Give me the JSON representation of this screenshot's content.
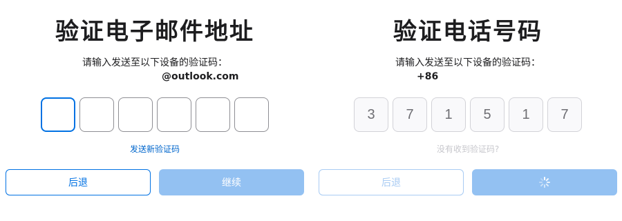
{
  "email_panel": {
    "title": "验证电子邮件地址",
    "subtitle": "请输入发送至以下设备的验证码：",
    "target": "@outlook.com",
    "code_digits": [
      "",
      "",
      "",
      "",
      "",
      ""
    ],
    "resend_link": "发送新验证码",
    "back_label": "后退",
    "continue_label": "继续"
  },
  "phone_panel": {
    "title": "验证电话号码",
    "subtitle": "请输入发送至以下设备的验证码：",
    "target": "+86",
    "code_digits": [
      "3",
      "7",
      "1",
      "5",
      "1",
      "7"
    ],
    "no_code_link": "没有收到验证码?",
    "back_label": "后退",
    "continue_icon": "loading-spinner-icon"
  },
  "colors": {
    "accent": "#0071e3",
    "button_disabled": "#93c1f2",
    "muted_link": "#c7c7cc"
  }
}
